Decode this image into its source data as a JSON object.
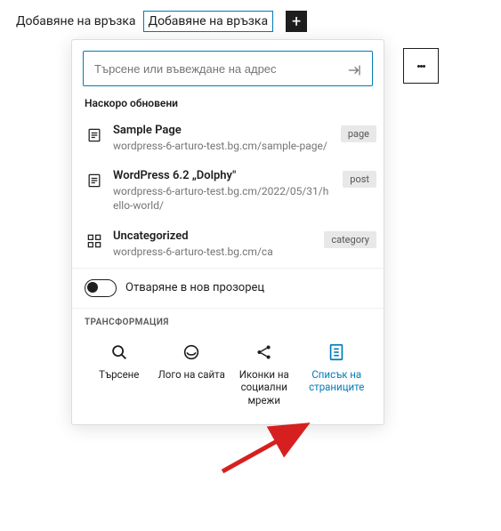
{
  "nav": {
    "items": [
      "Добавяне на връзка",
      "Добавяне на връзка"
    ],
    "selectedIndex": 1
  },
  "search": {
    "placeholder": "Търсене или въвеждане на адрес"
  },
  "recent": {
    "label": "Наскоро обновени",
    "items": [
      {
        "icon": "page",
        "title": "Sample Page",
        "url": "wordpress-6-arturo-test.bg.cm/sample-page/",
        "badge": "page"
      },
      {
        "icon": "post",
        "title": "WordPress 6.2 „Dolphy\"",
        "url": "wordpress-6-arturo-test.bg.cm/2022/05/31/hello-world/",
        "badge": "post"
      },
      {
        "icon": "category",
        "title": "Uncategorized",
        "url": "wordpress-6-arturo-test.bg.cm/ca",
        "badge": "category"
      }
    ]
  },
  "toggle": {
    "label": "Отваряне в нов прозорец",
    "checked": false
  },
  "transform": {
    "label": "ТРАНСФОРМАЦИЯ",
    "items": [
      {
        "name": "Търсене",
        "icon": "search"
      },
      {
        "name": "Лого на сайта",
        "icon": "logo"
      },
      {
        "name": "Иконки на социални мрежи",
        "icon": "share"
      },
      {
        "name": "Списък на страниците",
        "icon": "pagelist",
        "active": true
      }
    ]
  }
}
